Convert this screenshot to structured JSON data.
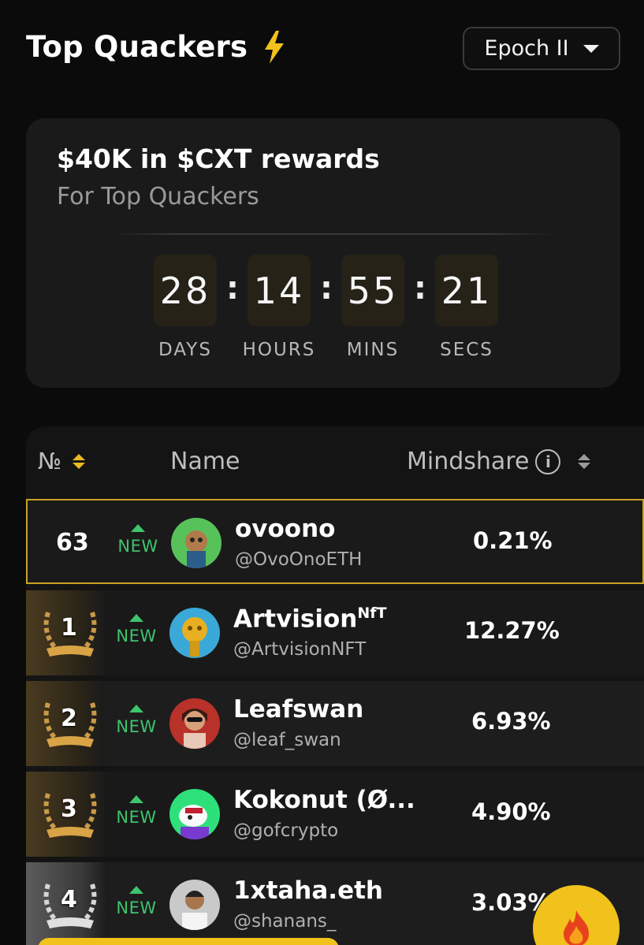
{
  "header": {
    "title": "Top Quackers",
    "bolt_icon": "lightning-bolt-icon",
    "epoch_label": "Epoch II"
  },
  "rewards": {
    "title": "$40K in $CXT rewards",
    "subtitle": "For Top Quackers",
    "countdown": {
      "days": "28",
      "hours": "14",
      "mins": "55",
      "secs": "21",
      "labels": {
        "days": "DAYS",
        "hours": "HOURS",
        "mins": "MINS",
        "secs": "SECS"
      }
    }
  },
  "table": {
    "headers": {
      "rank": "№",
      "name": "Name",
      "mindshare": "Mindshare"
    },
    "rows": [
      {
        "rank": "63",
        "status": "NEW",
        "name": "ovoono",
        "handle": "@OvoOnoETH",
        "mindshare": "0.21%",
        "highlight": true
      },
      {
        "rank": "1",
        "status": "NEW",
        "name": "Artvision",
        "name_sup": "NfT",
        "handle": "@ArtvisionNFT",
        "mindshare": "12.27%",
        "medal": "gold"
      },
      {
        "rank": "2",
        "status": "NEW",
        "name": "Leafswan",
        "handle": "@leaf_swan",
        "mindshare": "6.93%",
        "medal": "gold"
      },
      {
        "rank": "3",
        "status": "NEW",
        "name": "Kokonut (Ø...",
        "handle": "@gofcrypto",
        "mindshare": "4.90%",
        "medal": "gold"
      },
      {
        "rank": "4",
        "status": "NEW",
        "name": "1xtaha.eth",
        "handle": "@shanans_",
        "mindshare": "3.03%",
        "medal": "silver"
      }
    ]
  },
  "colors": {
    "accent": "#f1c21b",
    "positive": "#3ec46d",
    "background": "#0b0b0b"
  },
  "fab_icon": "flame-icon"
}
